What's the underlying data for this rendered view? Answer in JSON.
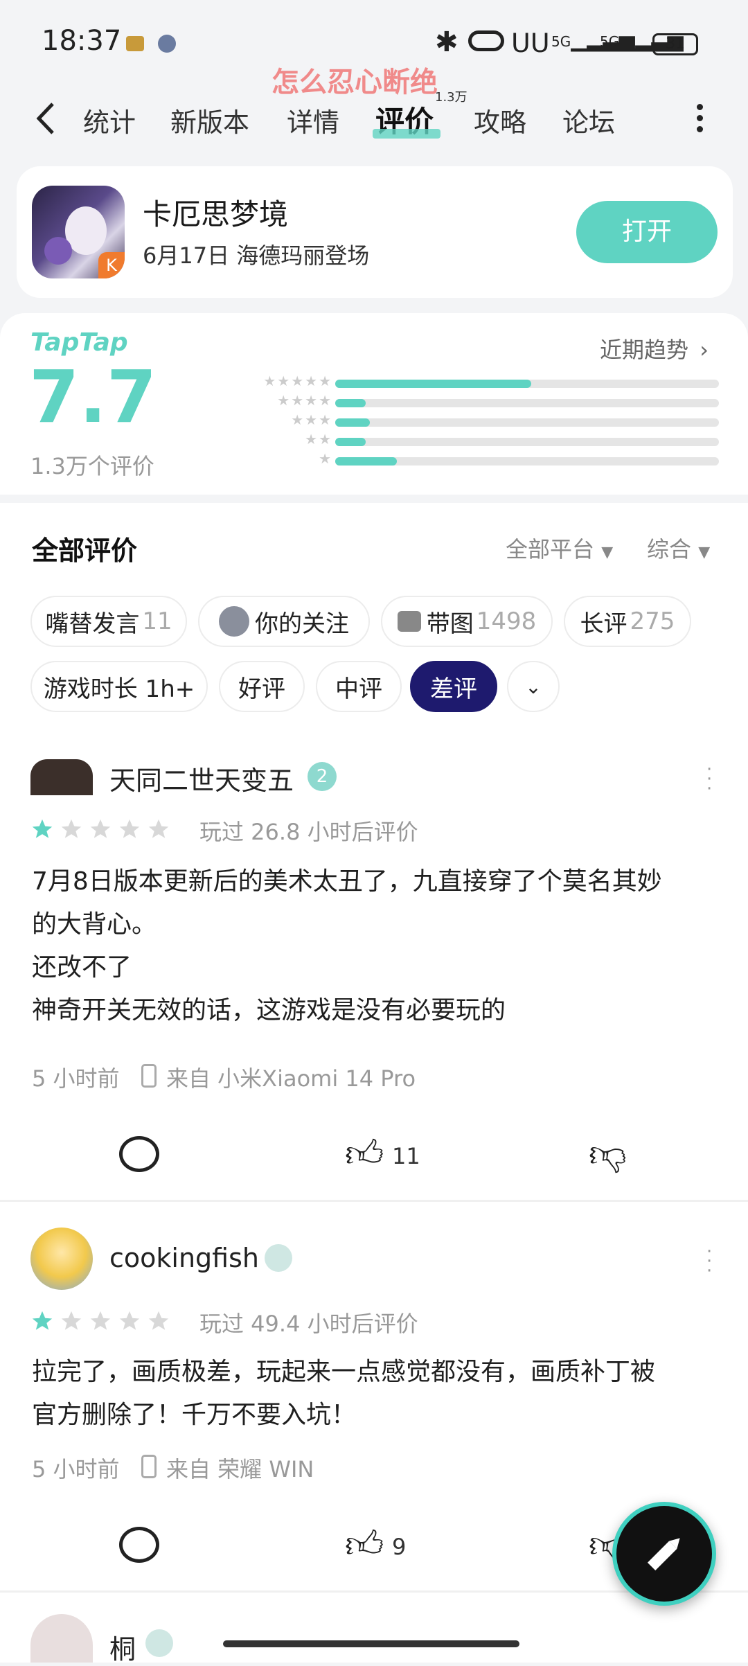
{
  "status": {
    "time": "18:37",
    "battery": "31",
    "net1": "5G",
    "net2": "5G"
  },
  "watermark": "怎么忍心断绝",
  "nav": {
    "tabs": [
      "统计",
      "新版本",
      "详情",
      "评价",
      "攻略",
      "论坛"
    ],
    "active": "评价",
    "badge": "1.3万"
  },
  "app": {
    "name": "卡厄思梦境",
    "subtitle": "6月17日 海德玛丽登场",
    "open_label": "打开"
  },
  "rating": {
    "brand": "TapTap",
    "score": "7.7",
    "count_label": "1.3万个评价",
    "trend_label": "近期趋势",
    "bars": [
      0.51,
      0.08,
      0.09,
      0.08,
      0.16
    ]
  },
  "reviews_header": {
    "title": "全部评价",
    "platform": "全部平台",
    "sort": "综合"
  },
  "filters": [
    {
      "label": "嘴替发言",
      "count": "11"
    },
    {
      "label": "你的关注",
      "count": ""
    },
    {
      "label": "带图",
      "count": "1498"
    },
    {
      "label": "长评",
      "count": "275"
    },
    {
      "label": "游戏时长 1h+",
      "count": ""
    },
    {
      "label": "好评",
      "count": ""
    },
    {
      "label": "中评",
      "count": ""
    },
    {
      "label": "差评",
      "count": ""
    }
  ],
  "reviews": [
    {
      "user": "天同二世天变五",
      "rating": 1,
      "played": "玩过 26.8 小时后评价",
      "lines": [
        "7月8日版本更新后的美术太丑了，九直接穿了个莫名其妙",
        "的大背心。",
        "还改不了",
        "神奇开关无效的话，这游戏是没有必要玩的"
      ],
      "time": "5 小时前",
      "device": "来自 小米Xiaomi 14 Pro",
      "likes": "11"
    },
    {
      "user": "cookingfish",
      "rating": 1,
      "played": "玩过 49.4 小时后评价",
      "lines": [
        "拉完了，画质极差，玩起来一点感觉都没有，画质补丁被",
        "官方删除了！千万不要入坑！"
      ],
      "time": "5 小时前",
      "device": "来自 荣耀 WIN",
      "likes": "9"
    },
    {
      "user": "桐"
    }
  ],
  "colors": {
    "accent": "#5fd3c2",
    "active_chip": "#1e1a6e",
    "star_on": "#5fd3c2",
    "star_off": "#d8d8d8"
  }
}
